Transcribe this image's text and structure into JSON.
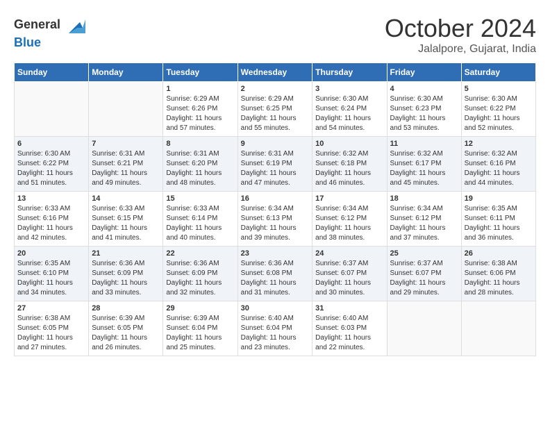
{
  "header": {
    "logo_general": "General",
    "logo_blue": "Blue",
    "month_title": "October 2024",
    "location": "Jalalpore, Gujarat, India"
  },
  "weekdays": [
    "Sunday",
    "Monday",
    "Tuesday",
    "Wednesday",
    "Thursday",
    "Friday",
    "Saturday"
  ],
  "weeks": [
    [
      {
        "day": "",
        "info": ""
      },
      {
        "day": "",
        "info": ""
      },
      {
        "day": "1",
        "info": "Sunrise: 6:29 AM\nSunset: 6:26 PM\nDaylight: 11 hours and 57 minutes."
      },
      {
        "day": "2",
        "info": "Sunrise: 6:29 AM\nSunset: 6:25 PM\nDaylight: 11 hours and 55 minutes."
      },
      {
        "day": "3",
        "info": "Sunrise: 6:30 AM\nSunset: 6:24 PM\nDaylight: 11 hours and 54 minutes."
      },
      {
        "day": "4",
        "info": "Sunrise: 6:30 AM\nSunset: 6:23 PM\nDaylight: 11 hours and 53 minutes."
      },
      {
        "day": "5",
        "info": "Sunrise: 6:30 AM\nSunset: 6:22 PM\nDaylight: 11 hours and 52 minutes."
      }
    ],
    [
      {
        "day": "6",
        "info": "Sunrise: 6:30 AM\nSunset: 6:22 PM\nDaylight: 11 hours and 51 minutes."
      },
      {
        "day": "7",
        "info": "Sunrise: 6:31 AM\nSunset: 6:21 PM\nDaylight: 11 hours and 49 minutes."
      },
      {
        "day": "8",
        "info": "Sunrise: 6:31 AM\nSunset: 6:20 PM\nDaylight: 11 hours and 48 minutes."
      },
      {
        "day": "9",
        "info": "Sunrise: 6:31 AM\nSunset: 6:19 PM\nDaylight: 11 hours and 47 minutes."
      },
      {
        "day": "10",
        "info": "Sunrise: 6:32 AM\nSunset: 6:18 PM\nDaylight: 11 hours and 46 minutes."
      },
      {
        "day": "11",
        "info": "Sunrise: 6:32 AM\nSunset: 6:17 PM\nDaylight: 11 hours and 45 minutes."
      },
      {
        "day": "12",
        "info": "Sunrise: 6:32 AM\nSunset: 6:16 PM\nDaylight: 11 hours and 44 minutes."
      }
    ],
    [
      {
        "day": "13",
        "info": "Sunrise: 6:33 AM\nSunset: 6:16 PM\nDaylight: 11 hours and 42 minutes."
      },
      {
        "day": "14",
        "info": "Sunrise: 6:33 AM\nSunset: 6:15 PM\nDaylight: 11 hours and 41 minutes."
      },
      {
        "day": "15",
        "info": "Sunrise: 6:33 AM\nSunset: 6:14 PM\nDaylight: 11 hours and 40 minutes."
      },
      {
        "day": "16",
        "info": "Sunrise: 6:34 AM\nSunset: 6:13 PM\nDaylight: 11 hours and 39 minutes."
      },
      {
        "day": "17",
        "info": "Sunrise: 6:34 AM\nSunset: 6:12 PM\nDaylight: 11 hours and 38 minutes."
      },
      {
        "day": "18",
        "info": "Sunrise: 6:34 AM\nSunset: 6:12 PM\nDaylight: 11 hours and 37 minutes."
      },
      {
        "day": "19",
        "info": "Sunrise: 6:35 AM\nSunset: 6:11 PM\nDaylight: 11 hours and 36 minutes."
      }
    ],
    [
      {
        "day": "20",
        "info": "Sunrise: 6:35 AM\nSunset: 6:10 PM\nDaylight: 11 hours and 34 minutes."
      },
      {
        "day": "21",
        "info": "Sunrise: 6:36 AM\nSunset: 6:09 PM\nDaylight: 11 hours and 33 minutes."
      },
      {
        "day": "22",
        "info": "Sunrise: 6:36 AM\nSunset: 6:09 PM\nDaylight: 11 hours and 32 minutes."
      },
      {
        "day": "23",
        "info": "Sunrise: 6:36 AM\nSunset: 6:08 PM\nDaylight: 11 hours and 31 minutes."
      },
      {
        "day": "24",
        "info": "Sunrise: 6:37 AM\nSunset: 6:07 PM\nDaylight: 11 hours and 30 minutes."
      },
      {
        "day": "25",
        "info": "Sunrise: 6:37 AM\nSunset: 6:07 PM\nDaylight: 11 hours and 29 minutes."
      },
      {
        "day": "26",
        "info": "Sunrise: 6:38 AM\nSunset: 6:06 PM\nDaylight: 11 hours and 28 minutes."
      }
    ],
    [
      {
        "day": "27",
        "info": "Sunrise: 6:38 AM\nSunset: 6:05 PM\nDaylight: 11 hours and 27 minutes."
      },
      {
        "day": "28",
        "info": "Sunrise: 6:39 AM\nSunset: 6:05 PM\nDaylight: 11 hours and 26 minutes."
      },
      {
        "day": "29",
        "info": "Sunrise: 6:39 AM\nSunset: 6:04 PM\nDaylight: 11 hours and 25 minutes."
      },
      {
        "day": "30",
        "info": "Sunrise: 6:40 AM\nSunset: 6:04 PM\nDaylight: 11 hours and 23 minutes."
      },
      {
        "day": "31",
        "info": "Sunrise: 6:40 AM\nSunset: 6:03 PM\nDaylight: 11 hours and 22 minutes."
      },
      {
        "day": "",
        "info": ""
      },
      {
        "day": "",
        "info": ""
      }
    ]
  ]
}
